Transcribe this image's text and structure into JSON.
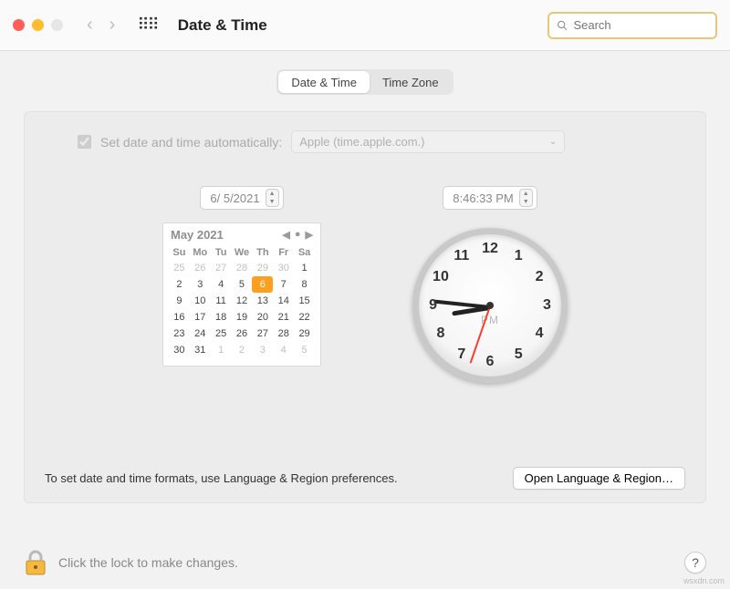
{
  "window": {
    "title": "Date & Time",
    "search_placeholder": "Search"
  },
  "tabs": {
    "active": "Date & Time",
    "items": [
      "Date & Time",
      "Time Zone"
    ]
  },
  "auto": {
    "checked": true,
    "label": "Set date and time automatically:",
    "server": "Apple (time.apple.com.)"
  },
  "date": {
    "field_value": "6/  5/2021",
    "calendar": {
      "month_label": "May 2021",
      "dow": [
        "Su",
        "Mo",
        "Tu",
        "We",
        "Th",
        "Fr",
        "Sa"
      ],
      "weeks": [
        [
          {
            "n": 25,
            "out": true
          },
          {
            "n": 26,
            "out": true
          },
          {
            "n": 27,
            "out": true
          },
          {
            "n": 28,
            "out": true
          },
          {
            "n": 29,
            "out": true
          },
          {
            "n": 30,
            "out": true
          },
          {
            "n": 1
          }
        ],
        [
          {
            "n": 2
          },
          {
            "n": 3
          },
          {
            "n": 4
          },
          {
            "n": 5
          },
          {
            "n": 6,
            "sel": true
          },
          {
            "n": 7
          },
          {
            "n": 8
          }
        ],
        [
          {
            "n": 9
          },
          {
            "n": 10
          },
          {
            "n": 11
          },
          {
            "n": 12
          },
          {
            "n": 13
          },
          {
            "n": 14
          },
          {
            "n": 15
          }
        ],
        [
          {
            "n": 16
          },
          {
            "n": 17
          },
          {
            "n": 18
          },
          {
            "n": 19
          },
          {
            "n": 20
          },
          {
            "n": 21
          },
          {
            "n": 22
          }
        ],
        [
          {
            "n": 23
          },
          {
            "n": 24
          },
          {
            "n": 25
          },
          {
            "n": 26
          },
          {
            "n": 27
          },
          {
            "n": 28
          },
          {
            "n": 29
          }
        ],
        [
          {
            "n": 30
          },
          {
            "n": 31
          },
          {
            "n": 1,
            "out": true
          },
          {
            "n": 2,
            "out": true
          },
          {
            "n": 3,
            "out": true
          },
          {
            "n": 4,
            "out": true
          },
          {
            "n": 5,
            "out": true
          }
        ]
      ]
    }
  },
  "time": {
    "field_value": "8:46:33 PM",
    "ampm": "PM",
    "clock_numbers": [
      "12",
      "1",
      "2",
      "3",
      "4",
      "5",
      "6",
      "7",
      "8",
      "9",
      "10",
      "11"
    ]
  },
  "footer": {
    "note": "To set date and time formats, use Language & Region preferences.",
    "button": "Open Language & Region…"
  },
  "lock": {
    "message": "Click the lock to make changes."
  },
  "watermark": "wsxdn.com"
}
